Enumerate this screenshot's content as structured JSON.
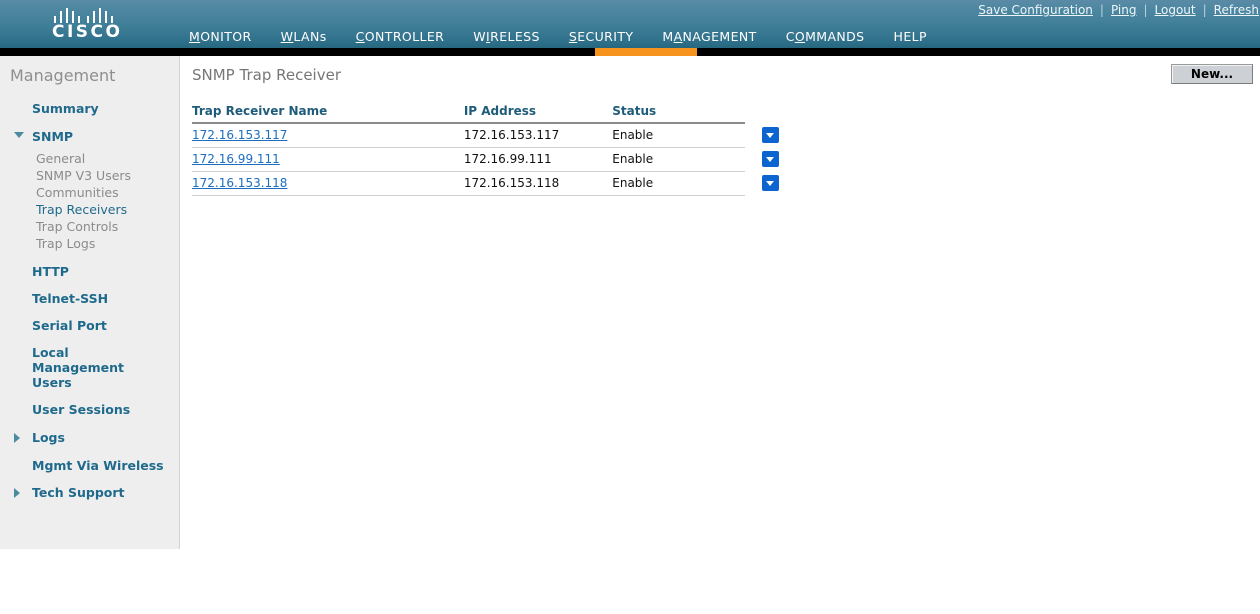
{
  "header": {
    "brand": "CISCO",
    "utility_links": [
      "Save Configuration",
      "Ping",
      "Logout",
      "Refresh"
    ],
    "separator": "|",
    "nav": [
      {
        "label": "MONITOR",
        "accel": "M",
        "active": false
      },
      {
        "label": "WLANs",
        "accel": "W",
        "active": false
      },
      {
        "label": "CONTROLLER",
        "accel": "C",
        "active": false
      },
      {
        "label": "WIRELESS",
        "accel": "I",
        "active": false
      },
      {
        "label": "SECURITY",
        "accel": "S",
        "active": false
      },
      {
        "label": "MANAGEMENT",
        "accel": "A",
        "active": true
      },
      {
        "label": "COMMANDS",
        "accel": "O",
        "active": false
      },
      {
        "label": "HELP",
        "accel": "H",
        "active": false
      }
    ],
    "accent_color": "#f6921e"
  },
  "sidebar": {
    "title": "Management",
    "items": [
      {
        "label": "Summary",
        "level": "top",
        "icon": "none"
      },
      {
        "label": "SNMP",
        "level": "top",
        "icon": "triangle-down-icon",
        "expanded": true
      },
      {
        "label": "General",
        "level": "sub",
        "selected": false
      },
      {
        "label": "SNMP V3 Users",
        "level": "sub",
        "selected": false
      },
      {
        "label": "Communities",
        "level": "sub",
        "selected": false
      },
      {
        "label": "Trap Receivers",
        "level": "sub",
        "selected": true
      },
      {
        "label": "Trap Controls",
        "level": "sub",
        "selected": false
      },
      {
        "label": "Trap Logs",
        "level": "sub",
        "selected": false
      },
      {
        "label": "HTTP",
        "level": "top",
        "icon": "none"
      },
      {
        "label": "Telnet-SSH",
        "level": "top",
        "icon": "none"
      },
      {
        "label": "Serial Port",
        "level": "top",
        "icon": "none"
      },
      {
        "label": "Local Management Users",
        "level": "top",
        "icon": "none"
      },
      {
        "label": "User Sessions",
        "level": "top",
        "icon": "none"
      },
      {
        "label": "Logs",
        "level": "top",
        "icon": "triangle-right-icon",
        "expanded": false
      },
      {
        "label": "Mgmt Via Wireless",
        "level": "top",
        "icon": "none"
      },
      {
        "label": "Tech Support",
        "level": "top",
        "icon": "triangle-right-icon",
        "expanded": false
      }
    ]
  },
  "content": {
    "page_title": "SNMP Trap Receiver",
    "new_button": "New...",
    "table": {
      "columns": [
        "Trap Receiver Name",
        "IP Address",
        "Status"
      ],
      "rows": [
        {
          "name": "172.16.153.117",
          "ip": "172.16.153.117",
          "status": "Enable",
          "action": "dropdown-arrow-icon"
        },
        {
          "name": "172.16.99.111",
          "ip": "172.16.99.111",
          "status": "Enable",
          "action": "dropdown-arrow-icon"
        },
        {
          "name": "172.16.153.118",
          "ip": "172.16.153.118",
          "status": "Enable",
          "action": "dropdown-arrow-icon"
        }
      ]
    }
  }
}
